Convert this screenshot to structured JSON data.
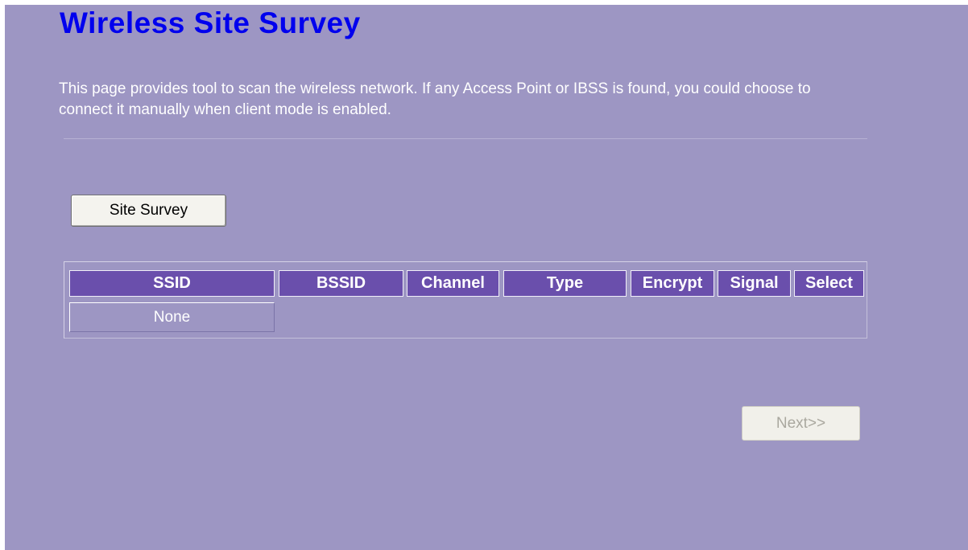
{
  "page": {
    "title": "Wireless Site Survey",
    "description": "This page provides tool to scan the wireless network. If any Access Point or IBSS is found, you could choose to connect it manually when client mode is enabled."
  },
  "buttons": {
    "site_survey": "Site Survey",
    "next": "Next>>",
    "next_enabled": false
  },
  "table": {
    "columns": [
      "SSID",
      "BSSID",
      "Channel",
      "Type",
      "Encrypt",
      "Signal",
      "Select"
    ],
    "rows": [
      {
        "ssid": "None"
      }
    ]
  },
  "colors": {
    "background": "#9d96c3",
    "title": "#0000ee",
    "header_fill": "#6a4fac",
    "text": "#ffffff"
  }
}
